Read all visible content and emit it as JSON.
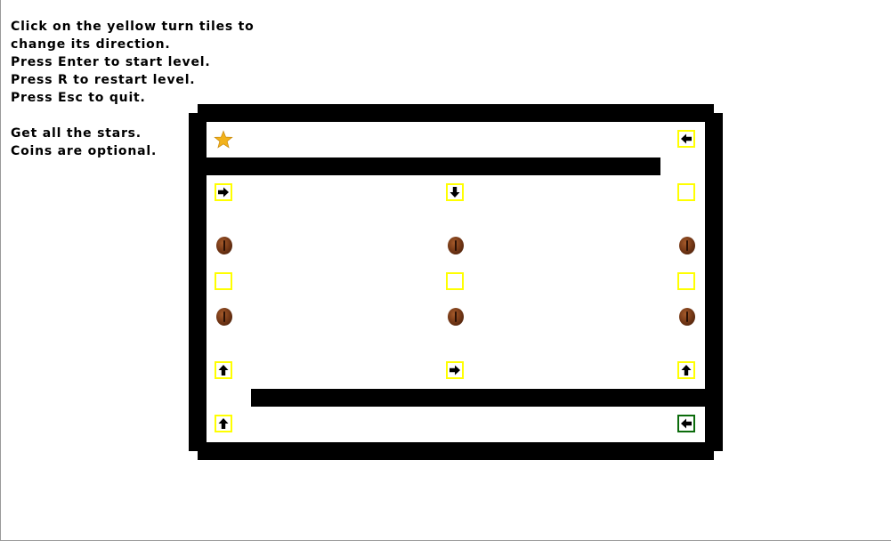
{
  "instructions": [
    "Click on the yellow turn tiles to",
    "change its direction.",
    "Press Enter to start level.",
    "Press R to restart level.",
    "Press Esc to quit.",
    "",
    "Get all the stars.",
    "Coins are optional."
  ],
  "colors": {
    "wall": "#000000",
    "turn_tile_border": "#ffff00",
    "exit_tile_border": "#0b6b0b",
    "star": "#f2b21b",
    "coin": "#6e3414"
  },
  "tiles": [
    {
      "id": "tile-r0-c2",
      "direction": "left"
    },
    {
      "id": "tile-r1-c0",
      "direction": "right"
    },
    {
      "id": "tile-r1-c1",
      "direction": "down"
    },
    {
      "id": "tile-r1-c2",
      "direction": "none"
    },
    {
      "id": "tile-r3-c0",
      "direction": "none"
    },
    {
      "id": "tile-r3-c1",
      "direction": "none"
    },
    {
      "id": "tile-r3-c2",
      "direction": "none"
    },
    {
      "id": "tile-r5-c0",
      "direction": "up"
    },
    {
      "id": "tile-r5-c1",
      "direction": "right"
    },
    {
      "id": "tile-r5-c2",
      "direction": "up"
    },
    {
      "id": "tile-r6-c0",
      "direction": "up"
    },
    {
      "id": "exit-tile",
      "direction": "left"
    }
  ]
}
